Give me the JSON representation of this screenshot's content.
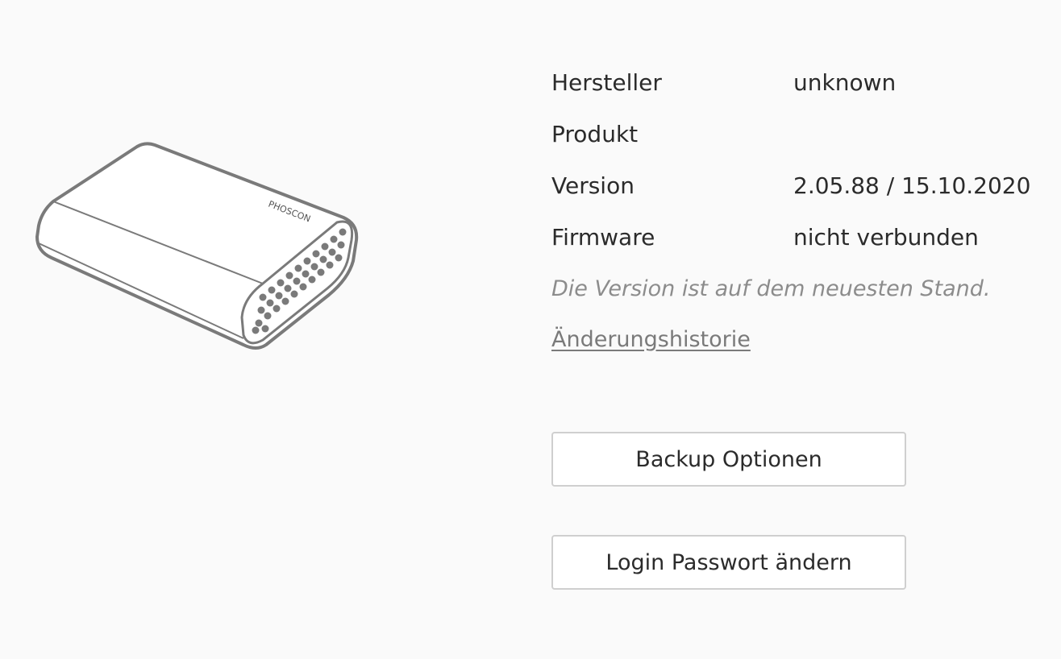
{
  "device": {
    "logo_text": "PHOSCON"
  },
  "info": {
    "rows": [
      {
        "label": "Hersteller",
        "value": "unknown"
      },
      {
        "label": "Produkt",
        "value": ""
      },
      {
        "label": "Version",
        "value": "2.05.88 / 15.10.2020"
      },
      {
        "label": "Firmware",
        "value": "nicht verbunden"
      }
    ],
    "status": "Die Version ist auf dem neuesten Stand.",
    "history_link": "Änderungshistorie"
  },
  "buttons": {
    "backup": "Backup Optionen",
    "password": "Login Passwort ändern"
  },
  "icons": {
    "device": "gateway-device-icon"
  },
  "colors": {
    "background": "#fafafa",
    "text": "#2b2b2b",
    "muted": "#8c8c8c",
    "button_border": "#cfcfcf"
  }
}
